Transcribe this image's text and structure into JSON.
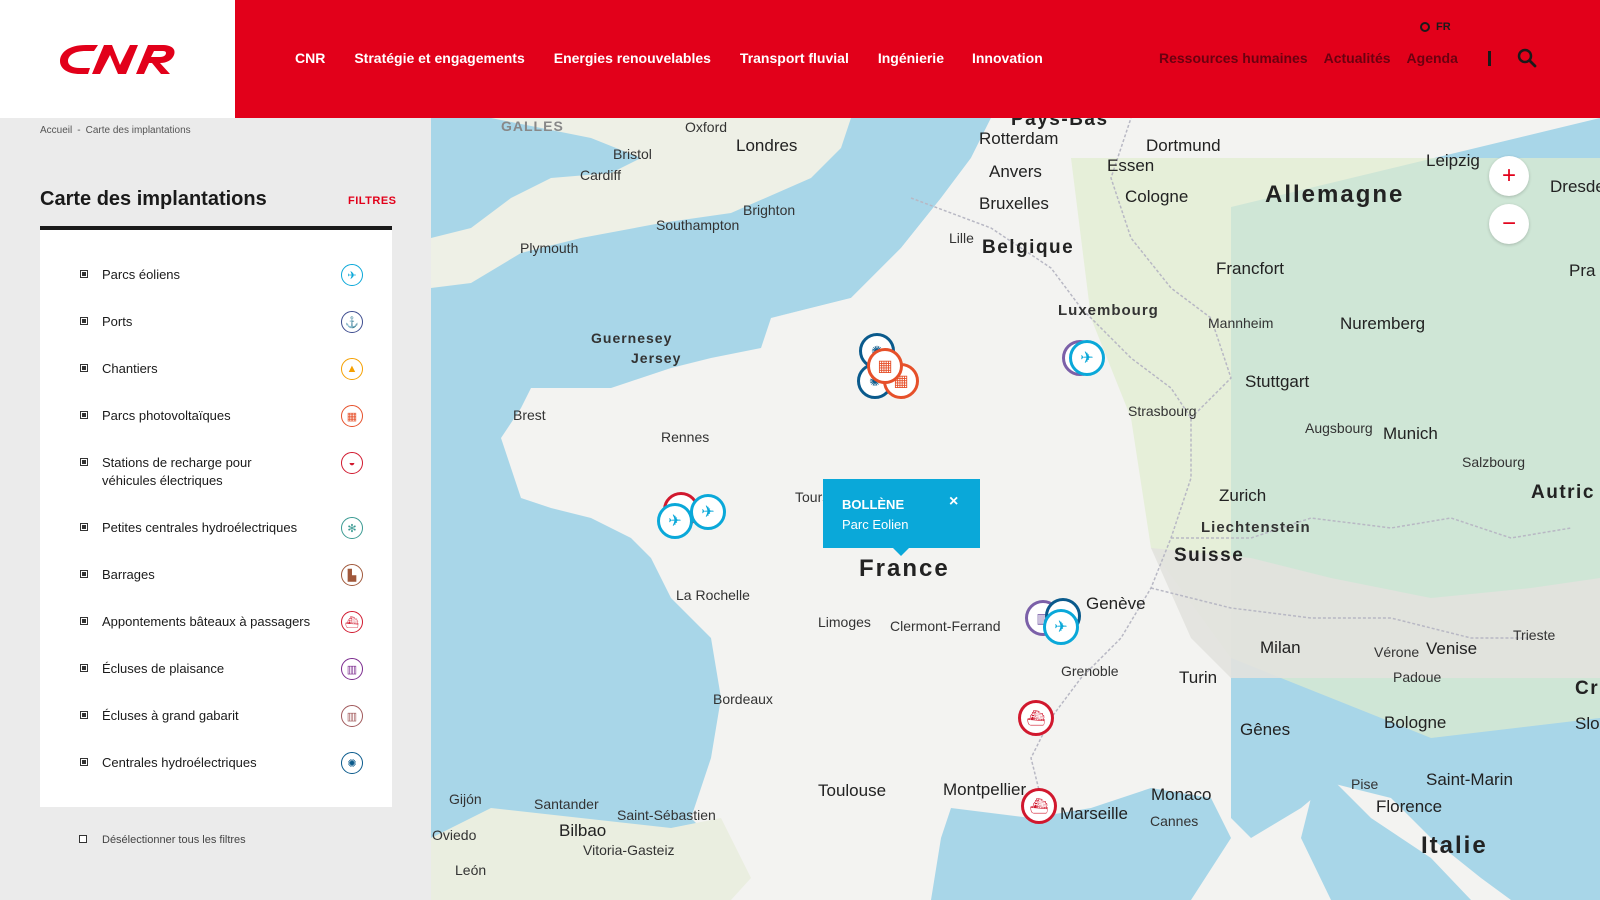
{
  "brand": {
    "logo_text": "CNR",
    "accent": "#e2001a",
    "popup_color": "#0aa8d9"
  },
  "header": {
    "nav": [
      "CNR",
      "Stratégie et engagements",
      "Energies renouvelables",
      "Transport fluvial",
      "Ingénierie",
      "Innovation"
    ],
    "lang": "FR",
    "secondary_nav": [
      "Ressources humaines",
      "Actualités",
      "Agenda"
    ],
    "search_icon": "search-icon"
  },
  "breadcrumb": {
    "home": "Accueil",
    "separator": "-",
    "current": "Carte des implantations"
  },
  "panel": {
    "title": "Carte des implantations",
    "filters_link": "FILTRES",
    "filters": [
      {
        "label": "Parcs éoliens",
        "icon": "wind-turbine-icon",
        "color": "#0aa8d9",
        "glyph": "✈"
      },
      {
        "label": "Ports",
        "icon": "anchor-icon",
        "color": "#3d4c8f",
        "glyph": "⚓"
      },
      {
        "label": "Chantiers",
        "icon": "cone-icon",
        "color": "#f5a000",
        "glyph": "▲"
      },
      {
        "label": "Parcs photovoltaïques",
        "icon": "solar-panel-icon",
        "color": "#e6502a",
        "glyph": "▦"
      },
      {
        "label": "Stations de recharge pour véhicules électriques",
        "icon": "car-icon",
        "color": "#d1182e",
        "glyph": "◒"
      },
      {
        "label": "Petites centrales hydroélectriques",
        "icon": "small-turbine-icon",
        "color": "#3a9a92",
        "glyph": "✻"
      },
      {
        "label": "Barrages",
        "icon": "dam-icon",
        "color": "#a0583b",
        "glyph": "▙"
      },
      {
        "label": "Appontements bâteaux à passagers",
        "icon": "boat-icon",
        "color": "#d1182e",
        "glyph": "⛴"
      },
      {
        "label": "Écluses de plaisance",
        "icon": "lock-leisure-icon",
        "color": "#7b2a8e",
        "glyph": "▥"
      },
      {
        "label": "Écluses à grand gabarit",
        "icon": "lock-large-icon",
        "color": "#a0585a",
        "glyph": "▥"
      },
      {
        "label": "Centrales hydroélectriques",
        "icon": "hydro-turbine-icon",
        "color": "#0a5a8c",
        "glyph": "✺"
      }
    ],
    "deselect_label": "Désélectionner tous les filtres"
  },
  "map": {
    "zoom_in": "+",
    "zoom_out": "−",
    "popup": {
      "title": "BOLLÈNE",
      "subtitle": "Parc Eolien",
      "close": "×"
    },
    "countries": [
      "Allemagne",
      "Belgique",
      "Suisse",
      "France",
      "Italie",
      "Autric",
      "Luxembourg",
      "Liechtenstein",
      "Pays-Bas"
    ],
    "regions": [
      "GALLES",
      "Guernesey",
      "Jersey"
    ],
    "cities": [
      "Oxford",
      "Londres",
      "Bristol",
      "Cardiff",
      "Brighton",
      "Southampton",
      "Plymouth",
      "Rotterdam",
      "Dortmund",
      "Essen",
      "Anvers",
      "Cologne",
      "Bruxelles",
      "Lille",
      "Leipzig",
      "Dresde",
      "Francfort",
      "Mannheim",
      "Nuremberg",
      "Stuttgart",
      "Strasbourg",
      "Augsbourg",
      "Munich",
      "Salzbourg",
      "Zurich",
      "Brest",
      "Rennes",
      "Tours",
      "La Rochelle",
      "Limoges",
      "Clermont-Ferrand",
      "Genève",
      "Grenoble",
      "Bordeaux",
      "Turin",
      "Milan",
      "Vérone",
      "Venise",
      "Padoue",
      "Trieste",
      "Gênes",
      "Bologne",
      "Toulouse",
      "Montpellier",
      "Marseille",
      "Monaco",
      "Cannes",
      "Pise",
      "Florence",
      "Saint-Marin",
      "Gijón",
      "Santander",
      "Oviedo",
      "Bilbao",
      "Saint-Sébastien",
      "Vitoria-Gasteiz",
      "León",
      "Pra",
      "Slo",
      "Cr"
    ]
  }
}
